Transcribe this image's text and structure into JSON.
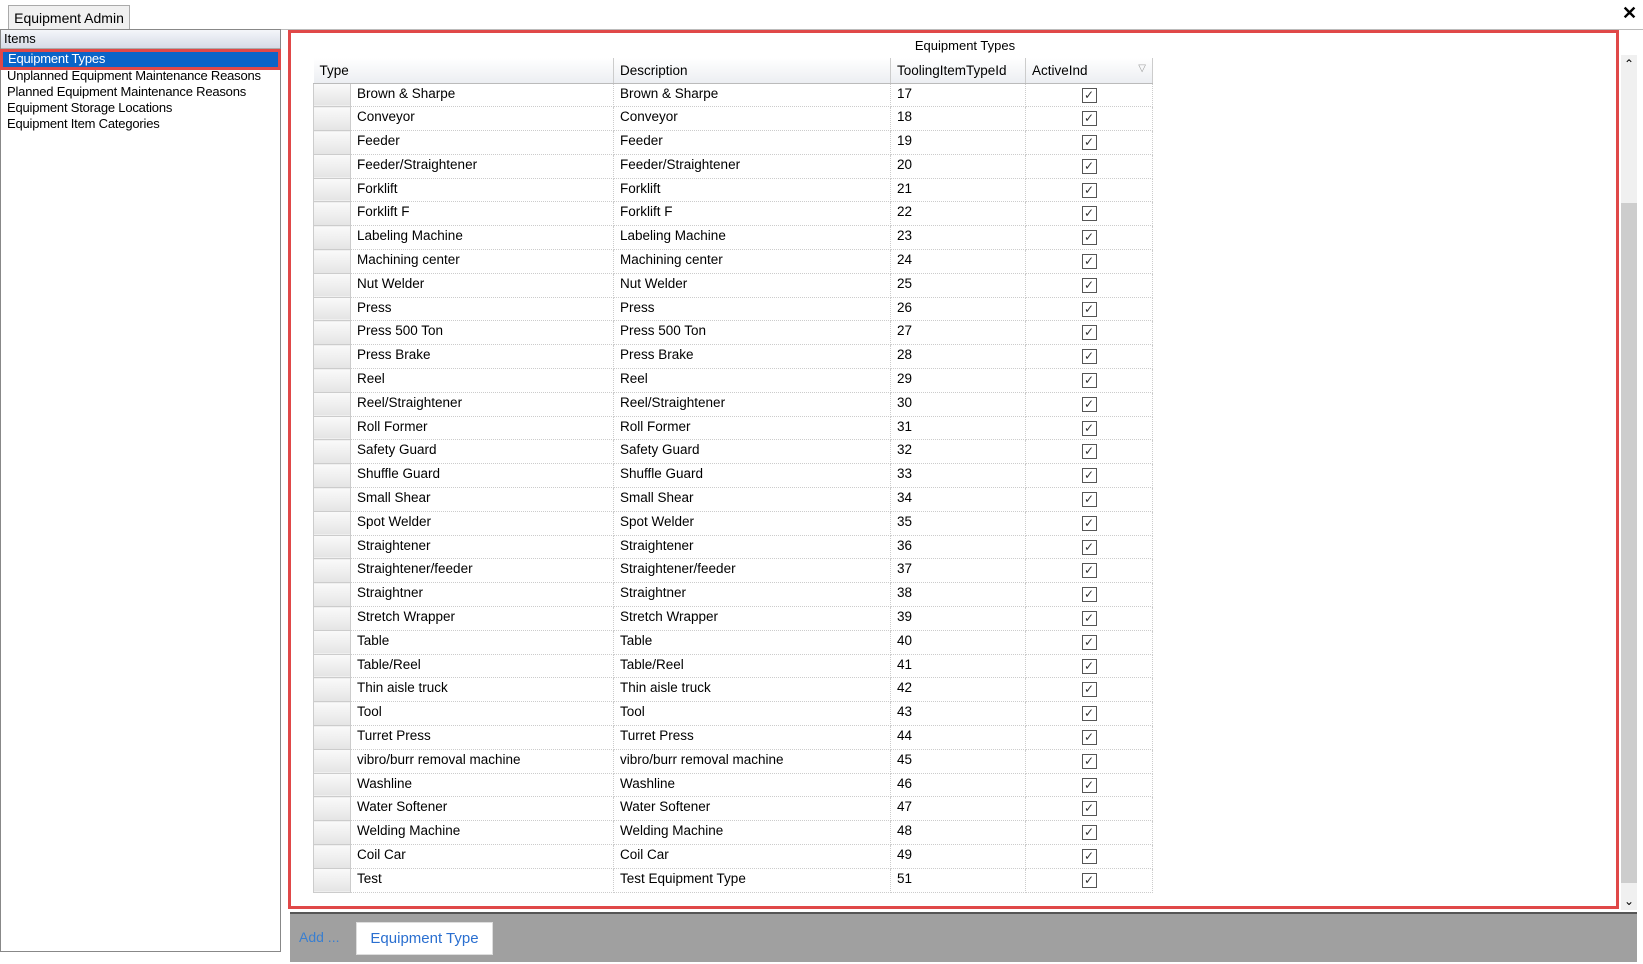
{
  "window": {
    "tab": "Equipment Admin",
    "close_icon": "close-icon"
  },
  "sidebar": {
    "header": "Items",
    "items": [
      {
        "label": "Equipment Types",
        "selected": true
      },
      {
        "label": "Unplanned Equipment Maintenance Reasons"
      },
      {
        "label": "Planned Equipment Maintenance Reasons"
      },
      {
        "label": "Equipment Storage Locations"
      },
      {
        "label": "Equipment Item Categories"
      }
    ]
  },
  "grid": {
    "title": "Equipment Types",
    "columns": [
      "Type",
      "Description",
      "ToolingItemTypeId",
      "ActiveInd"
    ],
    "rows": [
      [
        "Brown & Sharpe",
        "Brown & Sharpe",
        "17",
        true
      ],
      [
        "Conveyor",
        "Conveyor",
        "18",
        true
      ],
      [
        "Feeder",
        "Feeder",
        "19",
        true
      ],
      [
        "Feeder/Straightener",
        "Feeder/Straightener",
        "20",
        true
      ],
      [
        "Forklift",
        "Forklift",
        "21",
        true
      ],
      [
        "Forklift F",
        "Forklift F",
        "22",
        true
      ],
      [
        "Labeling Machine",
        "Labeling Machine",
        "23",
        true
      ],
      [
        "Machining center",
        "Machining center",
        "24",
        true
      ],
      [
        "Nut Welder",
        "Nut Welder",
        "25",
        true
      ],
      [
        "Press",
        "Press",
        "26",
        true
      ],
      [
        "Press 500 Ton",
        "Press 500 Ton",
        "27",
        true
      ],
      [
        "Press Brake",
        "Press Brake",
        "28",
        true
      ],
      [
        "Reel",
        "Reel",
        "29",
        true
      ],
      [
        "Reel/Straightener",
        "Reel/Straightener",
        "30",
        true
      ],
      [
        "Roll Former",
        "Roll Former",
        "31",
        true
      ],
      [
        "Safety Guard",
        "Safety Guard",
        "32",
        true
      ],
      [
        "Shuffle Guard",
        "Shuffle Guard",
        "33",
        true
      ],
      [
        "Small Shear",
        "Small Shear",
        "34",
        true
      ],
      [
        "Spot Welder",
        "Spot Welder",
        "35",
        true
      ],
      [
        "Straightener",
        "Straightener",
        "36",
        true
      ],
      [
        "Straightener/feeder",
        "Straightener/feeder",
        "37",
        true
      ],
      [
        "Straightner",
        "Straightner",
        "38",
        true
      ],
      [
        "Stretch Wrapper",
        "Stretch Wrapper",
        "39",
        true
      ],
      [
        "Table",
        "Table",
        "40",
        true
      ],
      [
        "Table/Reel",
        "Table/Reel",
        "41",
        true
      ],
      [
        "Thin aisle truck",
        "Thin aisle truck",
        "42",
        true
      ],
      [
        "Tool",
        "Tool",
        "43",
        true
      ],
      [
        "Turret Press",
        "Turret Press",
        "44",
        true
      ],
      [
        "vibro/burr removal machine",
        "vibro/burr removal machine",
        "45",
        true
      ],
      [
        "Washline",
        "Washline",
        "46",
        true
      ],
      [
        "Water Softener",
        "Water Softener",
        "47",
        true
      ],
      [
        "Welding Machine",
        "Welding Machine",
        "48",
        true
      ],
      [
        "Coil Car",
        "Coil Car",
        "49",
        true
      ],
      [
        "Test",
        "Test Equipment Type",
        "51",
        true
      ]
    ]
  },
  "footer": {
    "add_label": "Add ...",
    "button_label": "Equipment Type"
  },
  "colors": {
    "highlight": "#e04848",
    "selection": "#0a64c8",
    "link": "#3a7fd0"
  }
}
